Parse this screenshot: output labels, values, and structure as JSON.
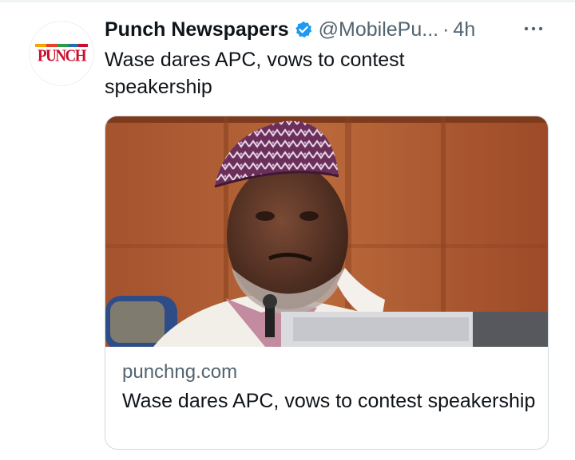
{
  "tweet": {
    "author_name": "Punch Newspapers",
    "handle": "@MobilePu...",
    "separator": "·",
    "time": "4h",
    "text": "Wase dares APC, vows to contest speakership",
    "avatar_logo_text": "PUNCH"
  },
  "card": {
    "domain": "punchng.com",
    "title": "Wase dares APC, vows to contest speakership"
  },
  "icons": {
    "verified": "verified-badge-icon",
    "more": "more-options-icon"
  },
  "colors": {
    "verified": "#1d9bf0",
    "secondary_text": "#536471",
    "brand_red": "#c8102e",
    "border": "#cfd9de"
  }
}
